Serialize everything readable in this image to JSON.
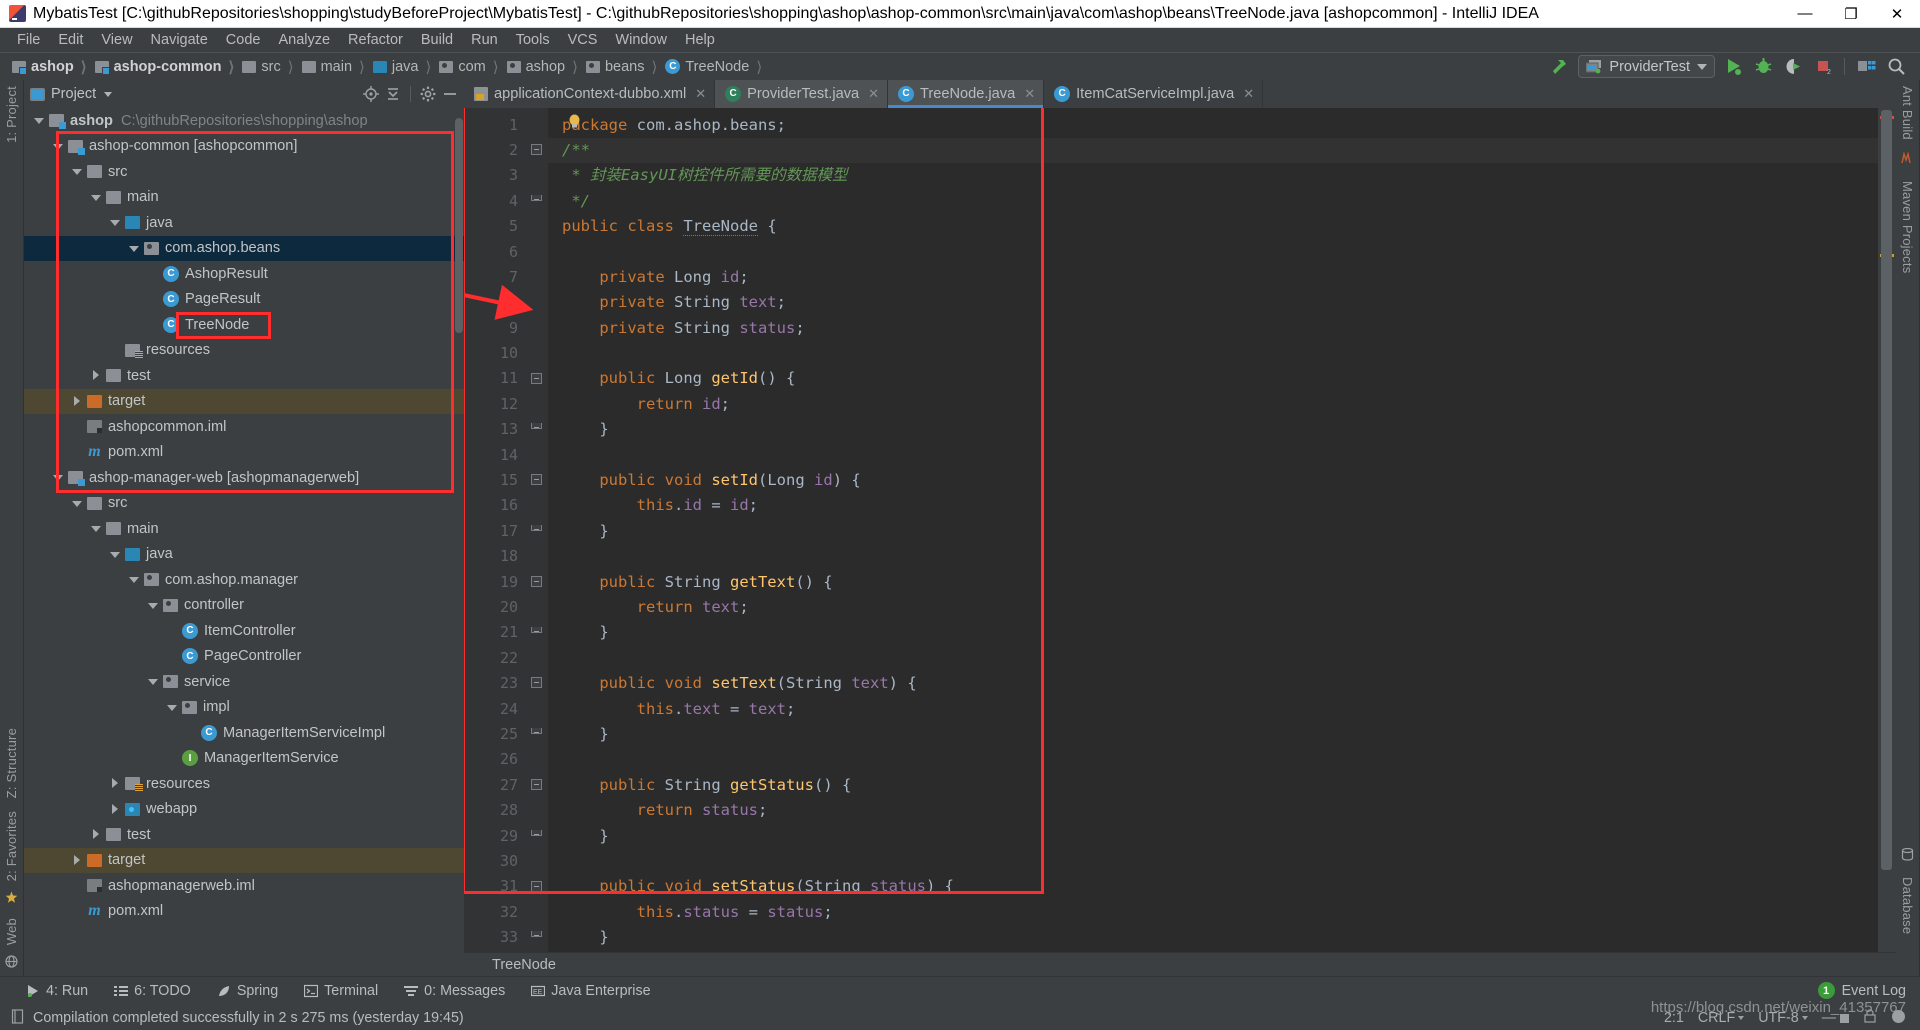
{
  "window": {
    "title": "MybatisTest [C:\\githubRepositories\\shopping\\studyBeforeProject\\MybatisTest] - C:\\githubRepositories\\shopping\\ashop\\ashop-common\\src\\main\\java\\com\\ashop\\beans\\TreeNode.java [ashopcommon] - IntelliJ IDEA",
    "minimize": "—",
    "maximize": "❐",
    "close": "✕"
  },
  "menubar": {
    "items": [
      "File",
      "Edit",
      "View",
      "Navigate",
      "Code",
      "Analyze",
      "Refactor",
      "Build",
      "Run",
      "Tools",
      "VCS",
      "Window",
      "Help"
    ]
  },
  "navbar": {
    "crumbs": [
      {
        "label": "ashop",
        "icon": "module-folder-icon",
        "bold": true
      },
      {
        "label": "ashop-common",
        "icon": "module-folder-icon",
        "bold": true
      },
      {
        "label": "src",
        "icon": "folder-icon",
        "bold": false
      },
      {
        "label": "main",
        "icon": "folder-icon",
        "bold": false
      },
      {
        "label": "java",
        "icon": "source-folder-icon",
        "bold": false
      },
      {
        "label": "com",
        "icon": "package-icon",
        "bold": false
      },
      {
        "label": "ashop",
        "icon": "package-icon",
        "bold": false
      },
      {
        "label": "beans",
        "icon": "package-icon",
        "bold": false
      },
      {
        "label": "TreeNode",
        "icon": "class-icon",
        "bold": false
      }
    ],
    "run_config": "ProviderTest",
    "buttons": [
      "build-hammer-icon",
      "run-icon",
      "debug-icon",
      "run-with-coverage-icon",
      "stop-icon",
      "project-structure-icon",
      "search-icon"
    ]
  },
  "project_panel": {
    "title": "Project",
    "toolbar_icons": [
      "locate-icon",
      "collapse-all-icon",
      "settings-gear-icon",
      "hide-icon"
    ],
    "tree": [
      {
        "depth": 0,
        "arrow": "down",
        "icon": "module-folder-icon",
        "label": "ashop",
        "bold": true,
        "path": "C:\\githubRepositories\\shopping\\ashop",
        "state": "normal"
      },
      {
        "depth": 1,
        "arrow": "down",
        "icon": "module-folder-icon",
        "label": "ashop-common [ashopcommon]",
        "bold": false,
        "path": "",
        "state": "normal"
      },
      {
        "depth": 2,
        "arrow": "down",
        "icon": "folder-icon",
        "label": "src",
        "bold": false,
        "path": "",
        "state": "normal"
      },
      {
        "depth": 3,
        "arrow": "down",
        "icon": "folder-icon",
        "label": "main",
        "bold": false,
        "path": "",
        "state": "normal"
      },
      {
        "depth": 4,
        "arrow": "down",
        "icon": "source-folder-icon",
        "label": "java",
        "bold": false,
        "path": "",
        "state": "normal"
      },
      {
        "depth": 5,
        "arrow": "down",
        "icon": "package-icon",
        "label": "com.ashop.beans",
        "bold": false,
        "path": "",
        "state": "selected"
      },
      {
        "depth": 6,
        "arrow": "none",
        "icon": "class-icon",
        "label": "AshopResult",
        "bold": false,
        "path": "",
        "state": "normal"
      },
      {
        "depth": 6,
        "arrow": "none",
        "icon": "class-icon",
        "label": "PageResult",
        "bold": false,
        "path": "",
        "state": "normal"
      },
      {
        "depth": 6,
        "arrow": "none",
        "icon": "class-icon",
        "label": "TreeNode",
        "bold": false,
        "path": "",
        "state": "normal"
      },
      {
        "depth": 4,
        "arrow": "none",
        "icon": "resources-folder-icon",
        "label": "resources",
        "bold": false,
        "path": "",
        "state": "normal"
      },
      {
        "depth": 3,
        "arrow": "right",
        "icon": "folder-icon",
        "label": "test",
        "bold": false,
        "path": "",
        "state": "normal"
      },
      {
        "depth": 2,
        "arrow": "right",
        "icon": "target-folder-icon",
        "label": "target",
        "bold": false,
        "path": "",
        "state": "highlight"
      },
      {
        "depth": 2,
        "arrow": "none",
        "icon": "iml-file-icon",
        "label": "ashopcommon.iml",
        "bold": false,
        "path": "",
        "state": "normal"
      },
      {
        "depth": 2,
        "arrow": "none",
        "icon": "maven-file-icon",
        "label": "pom.xml",
        "bold": false,
        "path": "",
        "state": "normal"
      },
      {
        "depth": 1,
        "arrow": "down",
        "icon": "module-folder-icon",
        "label": "ashop-manager-web [ashopmanagerweb]",
        "bold": false,
        "path": "",
        "state": "normal"
      },
      {
        "depth": 2,
        "arrow": "down",
        "icon": "folder-icon",
        "label": "src",
        "bold": false,
        "path": "",
        "state": "normal"
      },
      {
        "depth": 3,
        "arrow": "down",
        "icon": "folder-icon",
        "label": "main",
        "bold": false,
        "path": "",
        "state": "normal"
      },
      {
        "depth": 4,
        "arrow": "down",
        "icon": "source-folder-icon",
        "label": "java",
        "bold": false,
        "path": "",
        "state": "normal"
      },
      {
        "depth": 5,
        "arrow": "down",
        "icon": "package-icon",
        "label": "com.ashop.manager",
        "bold": false,
        "path": "",
        "state": "normal"
      },
      {
        "depth": 6,
        "arrow": "down",
        "icon": "package-icon",
        "label": "controller",
        "bold": false,
        "path": "",
        "state": "normal"
      },
      {
        "depth": 7,
        "arrow": "none",
        "icon": "class-icon",
        "label": "ItemController",
        "bold": false,
        "path": "",
        "state": "normal"
      },
      {
        "depth": 7,
        "arrow": "none",
        "icon": "class-icon",
        "label": "PageController",
        "bold": false,
        "path": "",
        "state": "normal"
      },
      {
        "depth": 6,
        "arrow": "down",
        "icon": "package-icon",
        "label": "service",
        "bold": false,
        "path": "",
        "state": "normal"
      },
      {
        "depth": 7,
        "arrow": "down",
        "icon": "package-icon",
        "label": "impl",
        "bold": false,
        "path": "",
        "state": "normal"
      },
      {
        "depth": 8,
        "arrow": "none",
        "icon": "class-icon",
        "label": "ManagerItemServiceImpl",
        "bold": false,
        "path": "",
        "state": "normal"
      },
      {
        "depth": 7,
        "arrow": "none",
        "icon": "interface-icon",
        "label": "ManagerItemService",
        "bold": false,
        "path": "",
        "state": "normal"
      },
      {
        "depth": 4,
        "arrow": "right",
        "icon": "resources-folder-icon",
        "label": "resources",
        "bold": false,
        "path": "",
        "state": "normal"
      },
      {
        "depth": 4,
        "arrow": "right",
        "icon": "webapp-folder-icon",
        "label": "webapp",
        "bold": false,
        "path": "",
        "state": "normal"
      },
      {
        "depth": 3,
        "arrow": "right",
        "icon": "folder-icon",
        "label": "test",
        "bold": false,
        "path": "",
        "state": "normal"
      },
      {
        "depth": 2,
        "arrow": "right",
        "icon": "target-folder-icon",
        "label": "target",
        "bold": false,
        "path": "",
        "state": "highlight"
      },
      {
        "depth": 2,
        "arrow": "none",
        "icon": "iml-file-icon",
        "label": "ashopmanagerweb.iml",
        "bold": false,
        "path": "",
        "state": "normal"
      },
      {
        "depth": 2,
        "arrow": "none",
        "icon": "maven-file-icon",
        "label": "pom.xml",
        "bold": false,
        "path": "",
        "state": "normal"
      }
    ]
  },
  "left_rail": {
    "items": [
      "1: Project",
      "Z: Structure",
      "2: Favorites",
      "Web"
    ]
  },
  "right_rail": {
    "items": [
      "Ant Build",
      "Maven Projects",
      "Database"
    ]
  },
  "editor": {
    "tabs": [
      {
        "label": "applicationContext-dubbo.xml",
        "icon": "xml-file-icon",
        "active": false,
        "close": "✕"
      },
      {
        "label": "ProviderTest.java",
        "icon": "test-class-icon",
        "active": true,
        "close": "✕"
      },
      {
        "label": "TreeNode.java",
        "icon": "class-icon",
        "active": true,
        "close": "✕"
      },
      {
        "label": "ItemCatServiceImpl.java",
        "icon": "class-icon",
        "active": false,
        "close": "✕"
      }
    ],
    "breadcrumb_bottom": "TreeNode",
    "first_line_number": 1,
    "total_visible_lines": 35,
    "code_lines": [
      "package com.ashop.beans;",
      "/**",
      " * 封装EasyUI树控件所需要的数据模型",
      " */",
      "public class TreeNode {",
      "",
      "    private Long id;",
      "    private String text;",
      "    private String status;",
      "",
      "    public Long getId() {",
      "        return id;",
      "    }",
      "",
      "    public void setId(Long id) {",
      "        this.id = id;",
      "    }",
      "",
      "    public String getText() {",
      "        return text;",
      "    }",
      "",
      "    public void setText(String text) {",
      "        this.text = text;",
      "    }",
      "",
      "    public String getStatus() {",
      "        return status;",
      "    }",
      "",
      "    public void setStatus(String status) {",
      "        this.status = status;",
      "    }",
      "",
      "}",
      ""
    ]
  },
  "toolwindow_bar": {
    "items": [
      {
        "label": "4: Run",
        "underline": "4",
        "icon": "run-icon"
      },
      {
        "label": "6: TODO",
        "underline": "6",
        "icon": "todo-icon"
      },
      {
        "label": "Spring",
        "underline": "",
        "icon": "spring-leaf-icon"
      },
      {
        "label": "Terminal",
        "underline": "",
        "icon": "terminal-icon"
      },
      {
        "label": "0: Messages",
        "underline": "0",
        "icon": "messages-icon"
      },
      {
        "label": "Java Enterprise",
        "underline": "",
        "icon": "java-enterprise-icon"
      }
    ],
    "event_log": {
      "label": "Event Log",
      "count": "1"
    }
  },
  "statusbar": {
    "message": "Compilation completed successfully in 2 s 275 ms (yesterday 19:45)",
    "caret": "2:1",
    "line_separator": "CRLF",
    "encoding": "UTF-8",
    "indent": "—"
  },
  "watermark": "https://blog.csdn.net/weixin_41357767",
  "colors": {
    "accent_blue": "#3c9ad3",
    "annotation_red": "#ff2d2d",
    "selection_blue": "#0d293e",
    "highlight_olive": "#4e4833",
    "editor_bg": "#2b2b2b",
    "chrome_bg": "#3c3f41"
  }
}
